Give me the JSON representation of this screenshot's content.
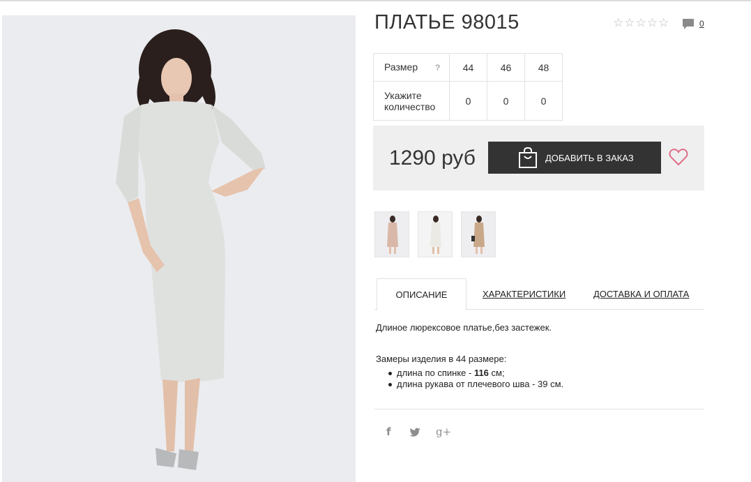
{
  "product": {
    "title": "ПЛАТЬЕ 98015",
    "rating_stars": 0,
    "comment_count": "0"
  },
  "size_table": {
    "size_label": "Размер",
    "size_help": "?",
    "sizes": [
      "44",
      "46",
      "48"
    ],
    "quantity_label": "Укажите количество",
    "quantities": [
      "0",
      "0",
      "0"
    ]
  },
  "buy": {
    "price": "1290 руб",
    "add_button_label": "ДОБАВИТЬ В ЗАКАЗ"
  },
  "tabs": [
    {
      "label": "ОПИСАНИЕ",
      "active": true
    },
    {
      "label": "ХАРАКТЕРИСТИКИ",
      "active": false
    },
    {
      "label": "ДОСТАВКА И ОПЛАТА",
      "active": false
    }
  ],
  "description": {
    "text": "Длиное люрексовое платье,без застежек.",
    "measure_heading": "Замеры изделия в 44 размере:",
    "measures": [
      {
        "label": "длина по спинке - ",
        "value": "116",
        "suffix": " см;"
      },
      {
        "label": "длина рукава от плечевого шва - 39 см.",
        "value": "",
        "suffix": ""
      }
    ]
  },
  "colors": {
    "dress": "#dfe1df",
    "thumb_pink": "#d9b8aa",
    "thumb_white": "#f3f1ec",
    "thumb_beige": "#c9a88a",
    "button_bg": "#333333",
    "heart": "#e06d87"
  },
  "icons": {
    "star": "☆",
    "facebook": "f",
    "twitter": "twitter-bird",
    "gplus": "g+"
  }
}
